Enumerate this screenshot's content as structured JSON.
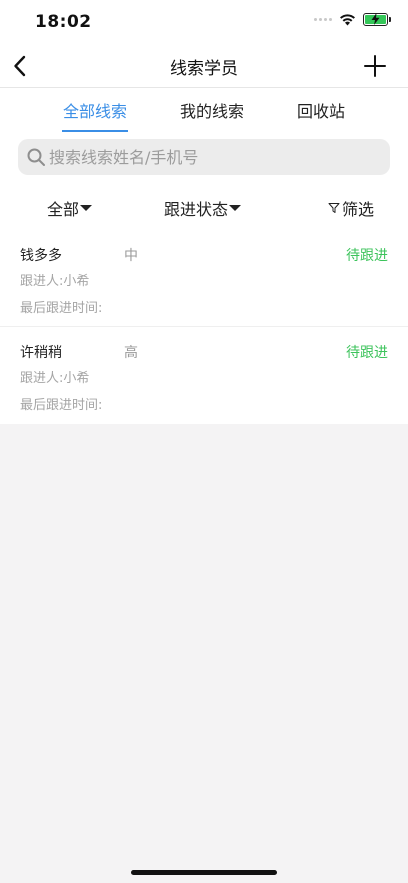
{
  "status_bar": {
    "time": "18:02"
  },
  "nav": {
    "title": "线索学员"
  },
  "tabs": [
    {
      "label": "全部线索",
      "active": true
    },
    {
      "label": "我的线索",
      "active": false
    },
    {
      "label": "回收站",
      "active": false
    }
  ],
  "search": {
    "placeholder": "搜索线索姓名/手机号",
    "value": ""
  },
  "filters": {
    "all_label": "全部",
    "status_label": "跟进状态",
    "filter_label": "筛选"
  },
  "leads": [
    {
      "name": "钱多多",
      "level": "中",
      "status": "待跟进",
      "follower_label": "跟进人:",
      "follower": "小希",
      "last_follow_label": "最后跟进时间:"
    },
    {
      "name": "许稍稍",
      "level": "高",
      "status": "待跟进",
      "follower_label": "跟进人:",
      "follower": "小希",
      "last_follow_label": "最后跟进时间:"
    }
  ],
  "colors": {
    "accent": "#3a8ee6",
    "status_green": "#3cc35b",
    "background": "#f4f3f4"
  },
  "icons": [
    "chevron-left-icon",
    "plus-icon",
    "search-icon",
    "funnel-icon",
    "wifi-icon",
    "battery-charging-icon"
  ]
}
